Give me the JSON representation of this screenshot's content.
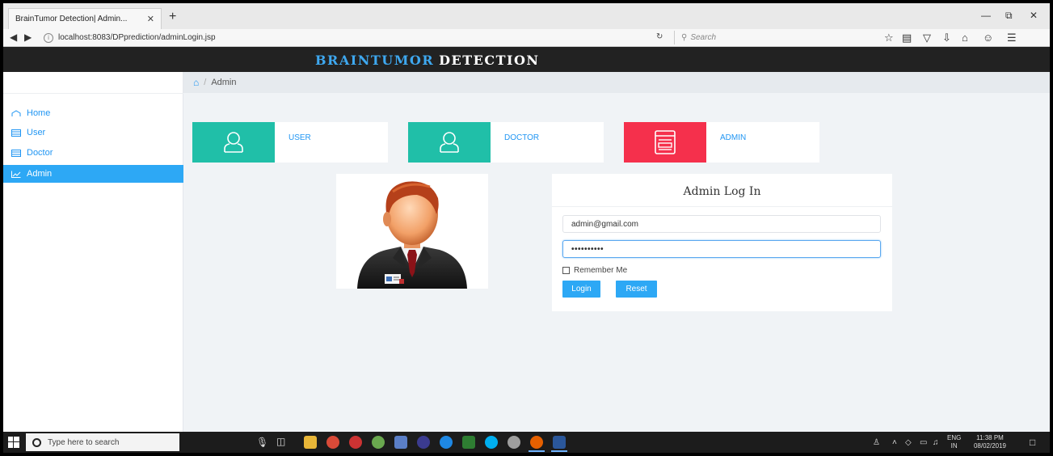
{
  "browser": {
    "tab_title": "BrainTumor Detection| Admin...",
    "tab_close": "✕",
    "new_tab": "+",
    "url": "localhost:8083/DPprediction/adminLogin.jsp",
    "search_placeholder": "Search",
    "win_controls": [
      "—",
      "⧉",
      "✕"
    ]
  },
  "app": {
    "brand_part1": "BRAINTUMOR",
    "brand_part2": "DETECTION",
    "brand_color": "#3ea8f0"
  },
  "sidebar": {
    "items": [
      {
        "label": "Home",
        "icon": "home-icon"
      },
      {
        "label": "User",
        "icon": "table-icon"
      },
      {
        "label": "Doctor",
        "icon": "table-icon"
      },
      {
        "label": "Admin",
        "icon": "chart-icon",
        "active": true
      }
    ]
  },
  "breadcrumb": {
    "current": "Admin"
  },
  "cards": [
    {
      "label": "USER",
      "color": "#20bfa8",
      "icon": "user-icon"
    },
    {
      "label": "DOCTOR",
      "color": "#20bfa8",
      "icon": "user-icon"
    },
    {
      "label": "ADMIN",
      "color": "#f5304c",
      "icon": "browser-window-icon"
    }
  ],
  "login": {
    "title": "Admin Log In",
    "email_value": "admin@gmail.com",
    "password_value": "••••••••••",
    "remember_label": "Remember Me",
    "login_button": "Login",
    "reset_button": "Reset",
    "accent": "#2da8f5"
  },
  "taskbar": {
    "search_placeholder": "Type here to search",
    "lang_line1": "ENG",
    "lang_line2": "IN",
    "time": "11:38 PM",
    "date": "08/02/2019"
  }
}
